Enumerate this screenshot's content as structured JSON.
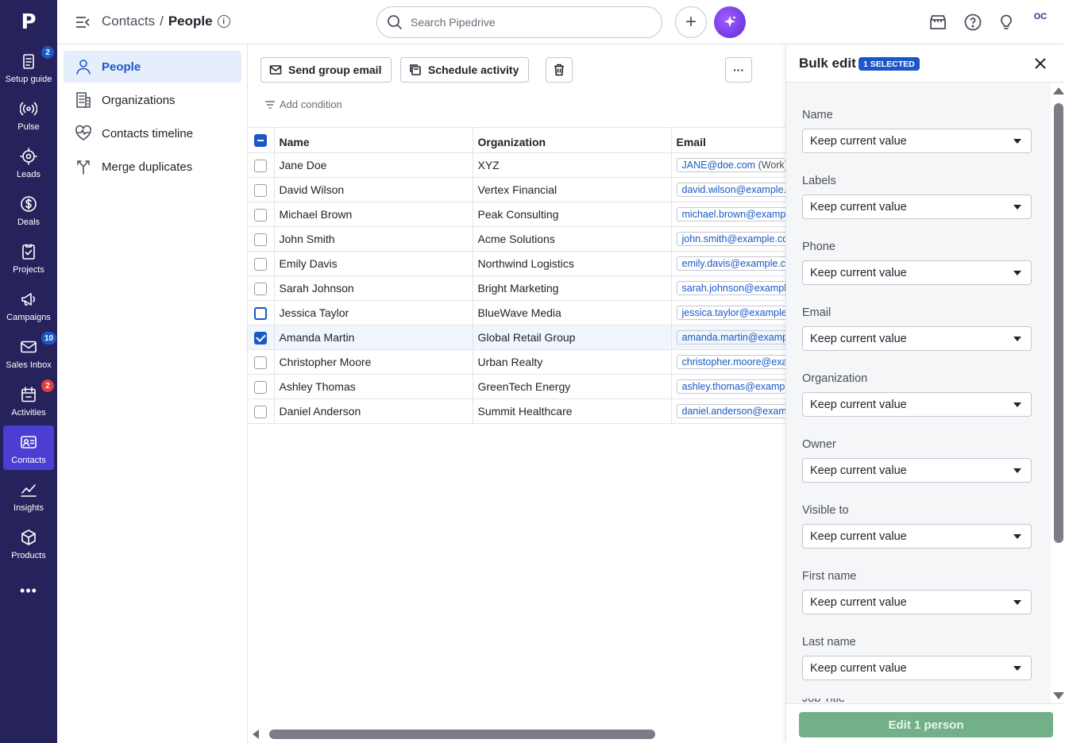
{
  "app": {
    "logo": "P",
    "rail": [
      {
        "id": "setup-guide",
        "label": "Setup guide",
        "icon": "clipboard-icon",
        "badge": "2",
        "badge_color": "#1b58c7"
      },
      {
        "id": "pulse",
        "label": "Pulse",
        "icon": "pulse-icon",
        "badge": "",
        "badge_color": ""
      },
      {
        "id": "leads",
        "label": "Leads",
        "icon": "target-icon",
        "badge": "",
        "badge_color": ""
      },
      {
        "id": "deals",
        "label": "Deals",
        "icon": "dollar-icon",
        "badge": "",
        "badge_color": ""
      },
      {
        "id": "projects",
        "label": "Projects",
        "icon": "checklist-icon",
        "badge": "",
        "badge_color": ""
      },
      {
        "id": "campaigns",
        "label": "Campaigns",
        "icon": "megaphone-icon",
        "badge": "",
        "badge_color": ""
      },
      {
        "id": "sales-inbox",
        "label": "Sales Inbox",
        "icon": "envelope-icon",
        "badge": "10",
        "badge_color": "#1b58c7"
      },
      {
        "id": "activities",
        "label": "Activities",
        "icon": "calendar-icon",
        "badge": "2",
        "badge_color": "#e33d3d"
      },
      {
        "id": "contacts",
        "label": "Contacts",
        "icon": "contact-card-icon",
        "badge": "",
        "badge_color": "",
        "active": true
      },
      {
        "id": "insights",
        "label": "Insights",
        "icon": "chart-icon",
        "badge": "",
        "badge_color": ""
      },
      {
        "id": "products",
        "label": "Products",
        "icon": "box-icon",
        "badge": "",
        "badge_color": ""
      }
    ],
    "more": "•••"
  },
  "header": {
    "crumb_parent": "Contacts",
    "crumb_sep": "/",
    "crumb_current": "People",
    "info": "i",
    "search_placeholder": "Search Pipedrive",
    "add": "+",
    "brand": "OC"
  },
  "sidenav": [
    {
      "label": "People",
      "icon": "person-icon",
      "active": true
    },
    {
      "label": "Organizations",
      "icon": "building-icon"
    },
    {
      "label": "Contacts timeline",
      "icon": "heart-pulse-icon"
    },
    {
      "label": "Merge duplicates",
      "icon": "merge-icon"
    }
  ],
  "toolbar": {
    "send_group_email": "Send group email",
    "schedule_activity": "Schedule activity",
    "more": "···",
    "add_condition": "Add condition"
  },
  "table": {
    "columns": [
      "Name",
      "Organization",
      "Email"
    ],
    "rows": [
      {
        "name": "Jane Doe",
        "org": "XYZ",
        "email": "JANE@doe.com",
        "email_type": "(Work)",
        "state": "off"
      },
      {
        "name": "David Wilson",
        "org": "Vertex Financial",
        "email": "david.wilson@example.com",
        "email_type": "",
        "state": "off"
      },
      {
        "name": "Michael Brown",
        "org": "Peak Consulting",
        "email": "michael.brown@example.com",
        "email_type": "",
        "state": "off"
      },
      {
        "name": "John Smith",
        "org": "Acme Solutions",
        "email": "john.smith@example.com",
        "email_type": "",
        "state": "off"
      },
      {
        "name": "Emily Davis",
        "org": "Northwind Logistics",
        "email": "emily.davis@example.com",
        "email_type": "",
        "state": "off"
      },
      {
        "name": "Sarah Johnson",
        "org": "Bright Marketing",
        "email": "sarah.johnson@example.com",
        "email_type": "",
        "state": "off"
      },
      {
        "name": "Jessica Taylor",
        "org": "BlueWave Media",
        "email": "jessica.taylor@example.com",
        "email_type": "",
        "state": "hover"
      },
      {
        "name": "Amanda Martin",
        "org": "Global Retail Group",
        "email": "amanda.martin@example.com",
        "email_type": "",
        "state": "on"
      },
      {
        "name": "Christopher Moore",
        "org": "Urban Realty",
        "email": "christopher.moore@example.com",
        "email_type": "",
        "state": "off"
      },
      {
        "name": "Ashley Thomas",
        "org": "GreenTech Energy",
        "email": "ashley.thomas@example.com",
        "email_type": "",
        "state": "off"
      },
      {
        "name": "Daniel Anderson",
        "org": "Summit Healthcare",
        "email": "daniel.anderson@example.com",
        "email_type": "",
        "state": "off"
      }
    ]
  },
  "bulk_edit": {
    "title": "Bulk edit",
    "badge": "1 SELECTED",
    "fields": [
      {
        "label": "Name",
        "value": "Keep current value"
      },
      {
        "label": "Labels",
        "value": "Keep current value"
      },
      {
        "label": "Phone",
        "value": "Keep current value"
      },
      {
        "label": "Email",
        "value": "Keep current value"
      },
      {
        "label": "Organization",
        "value": "Keep current value"
      },
      {
        "label": "Owner",
        "value": "Keep current value"
      },
      {
        "label": "Visible to",
        "value": "Keep current value"
      },
      {
        "label": "First name",
        "value": "Keep current value"
      },
      {
        "label": "Last name",
        "value": "Keep current value"
      }
    ],
    "partial_label": "Job Title",
    "submit": "Edit 1 person"
  }
}
